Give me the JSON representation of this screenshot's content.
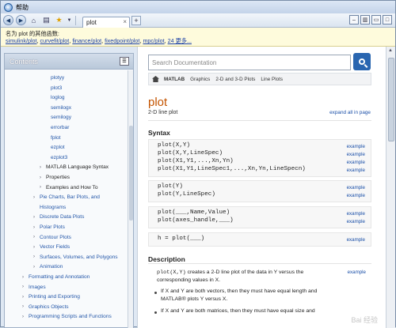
{
  "window": {
    "title": "帮助"
  },
  "toolbar": {
    "back_icon": "back-arrow-icon",
    "forward_icon": "forward-arrow-icon",
    "home_icon": "home-icon",
    "print_icon": "print-icon",
    "favorites_icon": "star-icon",
    "tab_label": "plot",
    "add_tab": "+"
  },
  "banner": {
    "prefix": "名为 plot 的其他函数:",
    "links": [
      "simulink/plot",
      "curvefit/plot",
      "finance/plot",
      "fixedpoint/plot",
      "mpc/plot",
      "24 更多..."
    ]
  },
  "sidebar": {
    "title": "Contents",
    "items": [
      {
        "label": "plotyy",
        "level": 3
      },
      {
        "label": "plot3",
        "level": 3
      },
      {
        "label": "loglog",
        "level": 3
      },
      {
        "label": "semilogx",
        "level": 3
      },
      {
        "label": "semilogy",
        "level": 3
      },
      {
        "label": "errorbar",
        "level": 3
      },
      {
        "label": "fplot",
        "level": 3
      },
      {
        "label": "ezplot",
        "level": 3
      },
      {
        "label": "ezplot3",
        "level": 3
      },
      {
        "label": "MATLAB Language Syntax",
        "level": 2,
        "arrow": true
      },
      {
        "label": "Properties",
        "level": 2,
        "arrow": true
      },
      {
        "label": "Examples and How To",
        "level": 2,
        "arrow": true
      },
      {
        "label": "Pie Charts, Bar Plots, and",
        "level": 1,
        "arrow": true
      },
      {
        "label": "Histograms",
        "level": 1,
        "cont": true
      },
      {
        "label": "Discrete Data Plots",
        "level": 1,
        "arrow": true
      },
      {
        "label": "Polar Plots",
        "level": 1,
        "arrow": true
      },
      {
        "label": "Contour Plots",
        "level": 1,
        "arrow": true
      },
      {
        "label": "Vector Fields",
        "level": 1,
        "arrow": true
      },
      {
        "label": "Surfaces, Volumes, and Polygons",
        "level": 1,
        "arrow": true
      },
      {
        "label": "Animation",
        "level": 1,
        "arrow": true
      },
      {
        "label": "Formatting and Annotation",
        "level": 0,
        "arrow": true
      },
      {
        "label": "Images",
        "level": 0,
        "arrow": true
      },
      {
        "label": "Printing and Exporting",
        "level": 0,
        "arrow": true
      },
      {
        "label": "Graphics Objects",
        "level": 0,
        "arrow": true
      },
      {
        "label": "Programming Scripts and Functions",
        "level": 0,
        "arrow": true
      }
    ]
  },
  "search": {
    "placeholder": "Search Documentation"
  },
  "breadcrumb": [
    "MATLAB",
    "Graphics",
    "2-D and 3-D Plots",
    "Line Plots"
  ],
  "page": {
    "title": "plot",
    "subtitle": "2-D line plot",
    "expand_all": "expand all in page",
    "syntax_heading": "Syntax",
    "syntax_groups": [
      [
        "plot(X,Y)",
        "plot(X,Y,LineSpec)",
        "plot(X1,Y1,...,Xn,Yn)",
        "plot(X1,Y1,LineSpec1,...,Xn,Yn,LineSpecn)"
      ],
      [
        "plot(Y)",
        "plot(Y,LineSpec)"
      ],
      [
        "plot(___,Name,Value)",
        "plot(axes_handle,___)"
      ],
      [
        "h = plot(___)"
      ]
    ],
    "example_label": "example",
    "description_heading": "Description",
    "desc_line1_code": "plot(X,Y)",
    "desc_line1_text": " creates a 2-D line plot of the data in Y versus the",
    "desc_line2": "corresponding values in X.",
    "bullet1_line1": "If X and Y are both vectors, then they must have equal length and",
    "bullet1_line2": "MATLAB® plots Y versus X.",
    "bullet2_line1": "If X and Y are both matrices, then they must have equal size and"
  },
  "watermark": "Bai 经验"
}
